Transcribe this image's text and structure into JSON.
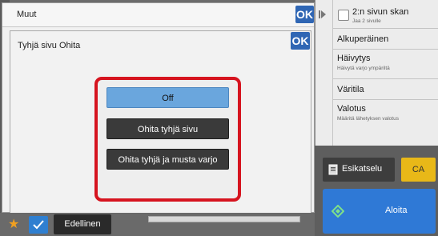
{
  "window": {
    "title": "Muut",
    "ok_label": "OK"
  },
  "dialog": {
    "title": "Tyhjä sivu Ohita",
    "ok_label": "OK",
    "options": [
      {
        "label": "Off",
        "selected": true
      },
      {
        "label": "Ohita tyhjä sivu",
        "selected": false
      },
      {
        "label": "Ohita tyhjä ja musta varjo",
        "selected": false
      }
    ]
  },
  "right_panel": {
    "items": [
      {
        "label": "2:n sivun skan",
        "sub": "Jaa 2 sivulle"
      },
      {
        "label": "Alkuperäinen",
        "sub": ""
      },
      {
        "label": "Häivytys",
        "sub": "Häivytä varjo ympäriltä"
      },
      {
        "label": "Väritila",
        "sub": ""
      },
      {
        "label": "Valotus",
        "sub": "Määritä lähetyksen valotus"
      }
    ],
    "preview_label": "Esikatselu",
    "ca_label": "CA",
    "start_label": "Aloita"
  },
  "bottom_bar": {
    "previous_label": "Edellinen"
  },
  "colors": {
    "accent": "#2f66b4",
    "highlight": "#d6141f",
    "start": "#2f79d6",
    "ca": "#e8b818"
  },
  "icons": [
    "star-icon",
    "check-icon",
    "arrow-icon",
    "preview-icon",
    "start-icon"
  ]
}
